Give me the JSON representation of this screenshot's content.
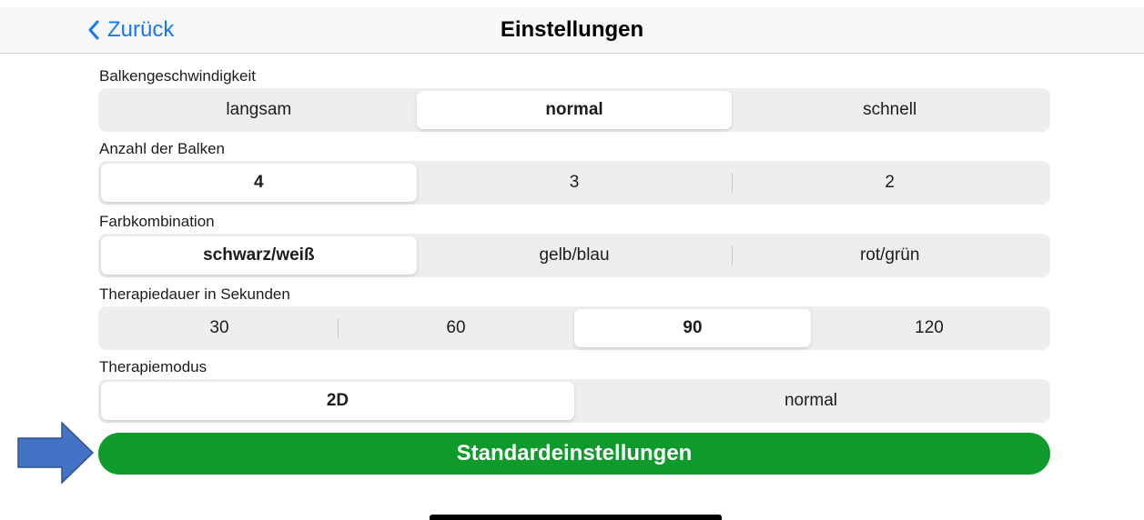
{
  "nav": {
    "back_label": "Zurück",
    "title": "Einstellungen"
  },
  "sections": {
    "speed": {
      "label": "Balkengeschwindigkeit",
      "options": [
        "langsam",
        "normal",
        "schnell"
      ],
      "selected": "normal"
    },
    "bars": {
      "label": "Anzahl der Balken",
      "options": [
        "4",
        "3",
        "2"
      ],
      "selected": "4"
    },
    "colors": {
      "label": "Farbkombination",
      "options": [
        "schwarz/weiß",
        "gelb/blau",
        "rot/grün"
      ],
      "selected": "schwarz/weiß"
    },
    "duration": {
      "label": "Therapiedauer in Sekunden",
      "options": [
        "30",
        "60",
        "90",
        "120"
      ],
      "selected": "90"
    },
    "mode": {
      "label": "Therapiemodus",
      "options": [
        "2D",
        "normal"
      ],
      "selected": "2D"
    }
  },
  "defaults_button": {
    "label": "Standardeinstellungen"
  },
  "colors": {
    "accent_blue": "#1677f2",
    "button_green": "#0e9b2c",
    "arrow_blue": "#4472c4"
  },
  "icons": {
    "back": "chevron-left-icon",
    "pointer": "arrow-right-icon"
  }
}
